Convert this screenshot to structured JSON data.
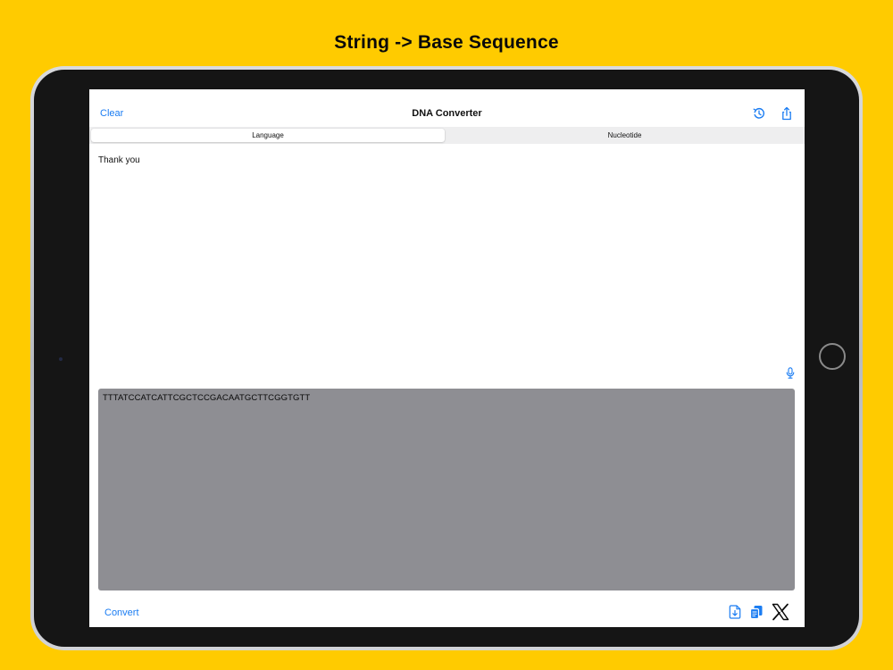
{
  "headline": "String -> Base Sequence",
  "nav": {
    "clear_label": "Clear",
    "title": "DNA Converter",
    "history_icon": "history-icon",
    "share_icon": "share-icon"
  },
  "segmented": {
    "options": [
      "Language",
      "Nucleotide"
    ],
    "selected": "Language"
  },
  "input": {
    "text": "Thank you",
    "mic_icon": "microphone-icon"
  },
  "output": {
    "text": "TTTATCCATCATTCGCTCCGACAATGCTTCGGTGTT"
  },
  "bottom_bar": {
    "convert_label": "Convert",
    "save_icon": "save-icon",
    "copy_icon": "copy-icon",
    "x_icon": "x-logo-icon"
  },
  "colors": {
    "background": "#FFCB00",
    "accent": "#1A7CF2",
    "output_box": "#8E8E93"
  }
}
